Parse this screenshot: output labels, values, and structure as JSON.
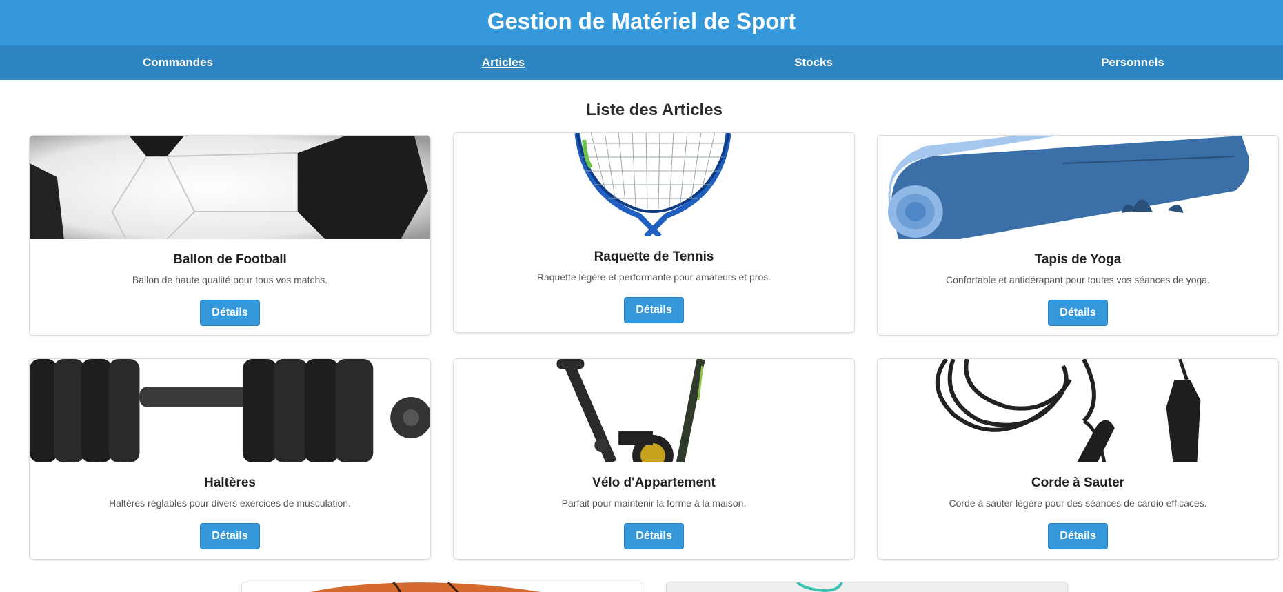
{
  "header": {
    "title": "Gestion de Matériel de Sport"
  },
  "nav": {
    "items": [
      {
        "label": "Commandes"
      },
      {
        "label": "Articles"
      },
      {
        "label": "Stocks"
      },
      {
        "label": "Personnels"
      }
    ],
    "active": "Articles"
  },
  "main": {
    "title": "Liste des Articles",
    "articles": [
      {
        "name": "Ballon de Football",
        "description": "Ballon de haute qualité pour tous vos matchs.",
        "button": "Détails",
        "image": "soccer-ball-image"
      },
      {
        "name": "Raquette de Tennis",
        "description": "Raquette légère et performante pour amateurs et pros.",
        "button": "Détails",
        "image": "tennis-racket-image"
      },
      {
        "name": "Tapis de Yoga",
        "description": "Confortable et antidérapant pour toutes vos séances de yoga.",
        "button": "Détails",
        "image": "yoga-mat-image"
      },
      {
        "name": "Haltères",
        "description": "Haltères réglables pour divers exercices de musculation.",
        "button": "Détails",
        "image": "dumbbell-image"
      },
      {
        "name": "Vélo d'Appartement",
        "description": "Parfait pour maintenir la forme à la maison.",
        "button": "Détails",
        "image": "exercise-bike-image"
      },
      {
        "name": "Corde à Sauter",
        "description": "Corde à sauter légère pour des séances de cardio efficaces.",
        "button": "Détails",
        "image": "jump-rope-image"
      },
      {
        "name": "",
        "description": "",
        "button": "",
        "image": "basketball-image"
      },
      {
        "name": "",
        "description": "",
        "button": "",
        "image": "item-image"
      }
    ]
  },
  "colors": {
    "primary": "#3498db",
    "nav": "#2d85c2"
  }
}
